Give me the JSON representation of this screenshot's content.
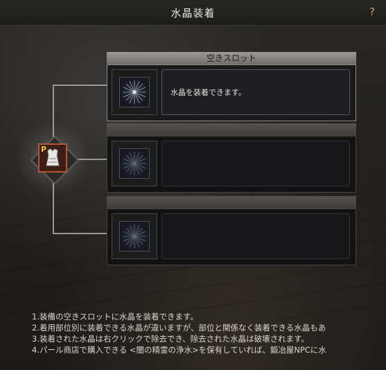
{
  "window": {
    "title": "水晶装着",
    "help_label": "?"
  },
  "equipment": {
    "grade_letter": "P",
    "icon": "armor-icon"
  },
  "slots": [
    {
      "header": "空きスロット",
      "description": "水晶を装着できます。",
      "icon": "crystal-slot-icon",
      "active": true
    },
    {
      "header": "",
      "description": "",
      "icon": "crystal-slot-icon",
      "active": false
    },
    {
      "header": "",
      "description": "",
      "icon": "crystal-slot-icon",
      "active": false
    }
  ],
  "notes": [
    "1.装備の空きスロットに水晶を装着できます。",
    "2.着用部位別に装着できる水晶が違いますが、部位と関係なく装着できる水晶もあ",
    "3.装着された水晶は右クリックで除去でき、除去された水晶は破壊されます。",
    "4.パール商店で購入できる <闇の精霊の浄水>を保有していれば、鍛冶屋NPCに水"
  ],
  "colors": {
    "accent": "#c9a86a",
    "equip_border": "#b5553a",
    "grade_letter": "#f2c34a"
  }
}
